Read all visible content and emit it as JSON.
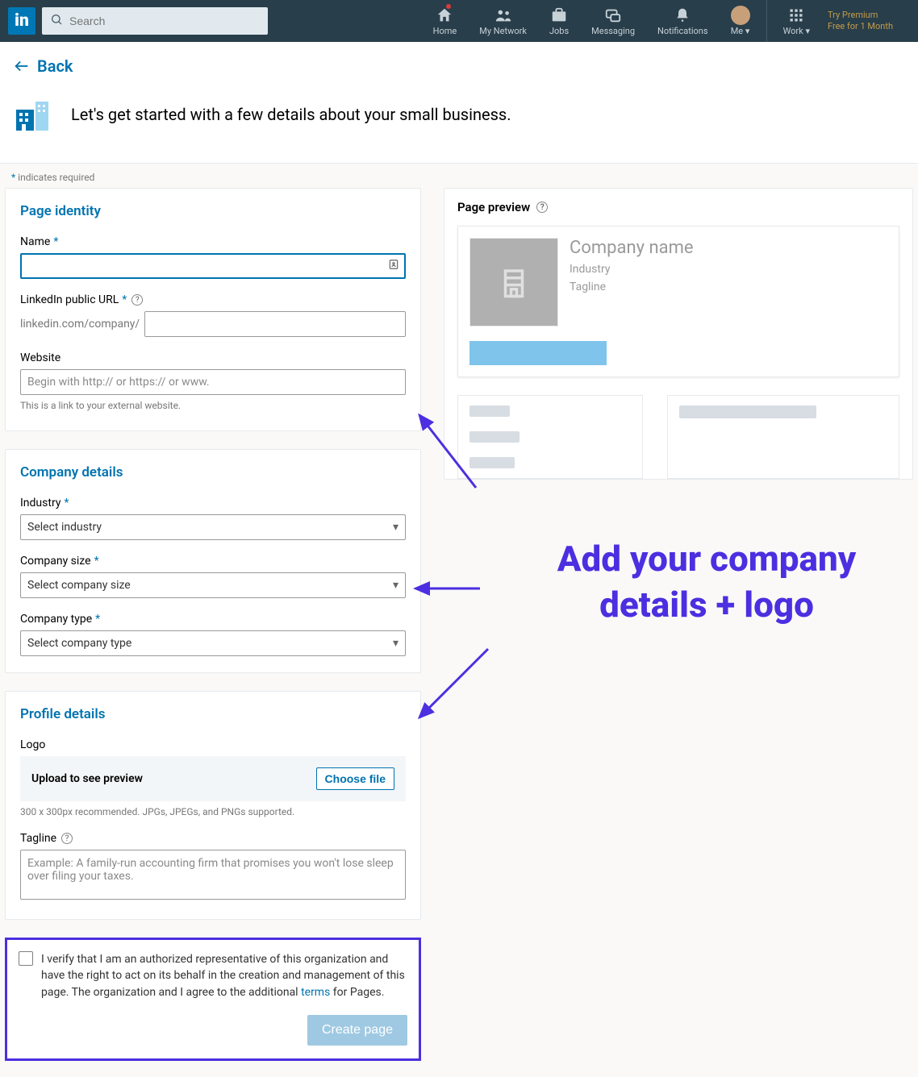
{
  "nav": {
    "search_placeholder": "Search",
    "items": {
      "home": "Home",
      "network": "My Network",
      "jobs": "Jobs",
      "messaging": "Messaging",
      "notifications": "Notifications",
      "me": "Me",
      "work": "Work"
    },
    "premium_line1": "Try Premium",
    "premium_line2": "Free for 1 Month"
  },
  "back": {
    "label": "Back"
  },
  "hero": {
    "text": "Let's get started with a few details about your small business."
  },
  "required_note": "indicates required",
  "identity": {
    "title": "Page identity",
    "name_label": "Name",
    "url_label": "LinkedIn public URL",
    "url_prefix": "linkedin.com/company/",
    "website_label": "Website",
    "website_placeholder": "Begin with http:// or https:// or www.",
    "website_hint": "This is a link to your external website."
  },
  "company": {
    "title": "Company details",
    "industry_label": "Industry",
    "industry_placeholder": "Select industry",
    "size_label": "Company size",
    "size_placeholder": "Select company size",
    "type_label": "Company type",
    "type_placeholder": "Select company type"
  },
  "profile": {
    "title": "Profile details",
    "logo_label": "Logo",
    "upload_label": "Upload to see preview",
    "choose_label": "Choose file",
    "upload_hint": "300 x 300px recommended. JPGs, JPEGs, and PNGs supported.",
    "tagline_label": "Tagline",
    "tagline_placeholder": "Example: A family-run accounting firm that promises you won't lose sleep over filing your taxes."
  },
  "verify": {
    "text_1": "I verify that I am an authorized representative of this organization and have the right to act on its behalf in the creation and management of this page. The organization and I agree to the additional ",
    "terms": "terms",
    "text_2": " for Pages.",
    "create_label": "Create page"
  },
  "preview": {
    "title": "Page preview",
    "name": "Company name",
    "industry": "Industry",
    "tagline": "Tagline"
  },
  "annotation": {
    "text": "Add your company details + logo"
  }
}
